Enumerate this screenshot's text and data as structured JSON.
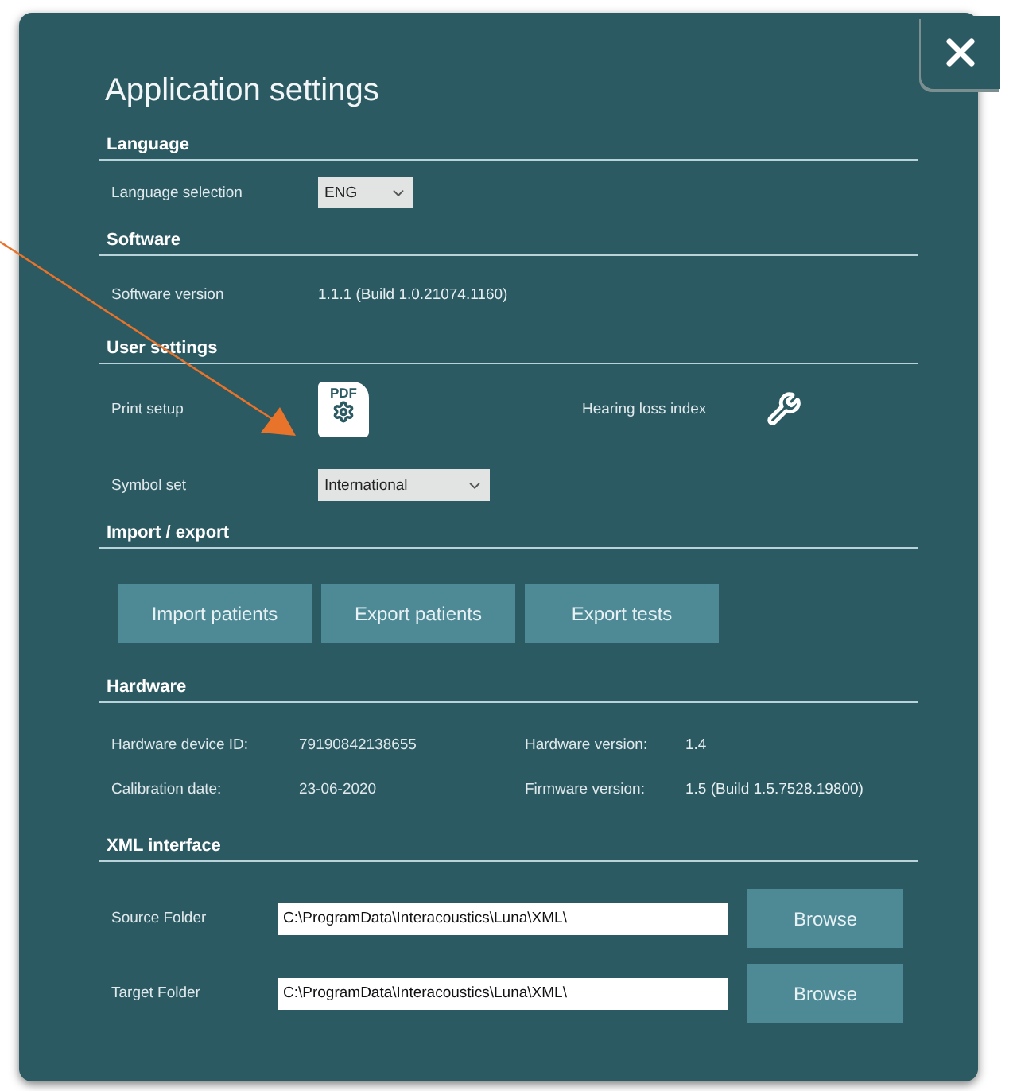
{
  "title": "Application settings",
  "sections": [
    {
      "heading": "Language",
      "kind": "rows",
      "rows": [
        {
          "kind": "select",
          "label": "Language selection",
          "value": "ENG"
        }
      ]
    },
    {
      "heading": "Software",
      "kind": "rows",
      "rows": [
        {
          "kind": "text",
          "label": "Software version",
          "value": "1.1.1 (Build 1.0.21074.1160)"
        }
      ]
    },
    {
      "heading": "User settings",
      "kind": "rows",
      "rows": [
        {
          "kind": "icons",
          "label": "Print setup",
          "label_2": "Hearing loss index",
          "icon_text": "PDF"
        },
        {
          "kind": "select",
          "label": "Symbol set",
          "value": "International"
        }
      ]
    },
    {
      "heading": "Import / export",
      "kind": "buttons",
      "buttons": [
        "Import patients",
        "Export patients",
        "Export tests"
      ]
    },
    {
      "heading": "Hardware",
      "kind": "pairs",
      "rows": [
        {
          "label": "Hardware device ID:",
          "value": "79190842138655",
          "label_2": "Hardware version:",
          "value_2": "1.4"
        },
        {
          "label": "Calibration date:",
          "value": "23-06-2020",
          "label_2": "Firmware version:",
          "value_2": "1.5 (Build 1.5.7528.19800)"
        }
      ]
    },
    {
      "heading": "XML interface",
      "kind": "folders",
      "rows": [
        {
          "label": "Source Folder",
          "value": "C:\\ProgramData\\Interacoustics\\Luna\\XML\\",
          "button": "Browse"
        },
        {
          "label": "Target Folder",
          "value": "C:\\ProgramData\\Interacoustics\\Luna\\XML\\",
          "button": "Browse"
        }
      ]
    }
  ]
}
